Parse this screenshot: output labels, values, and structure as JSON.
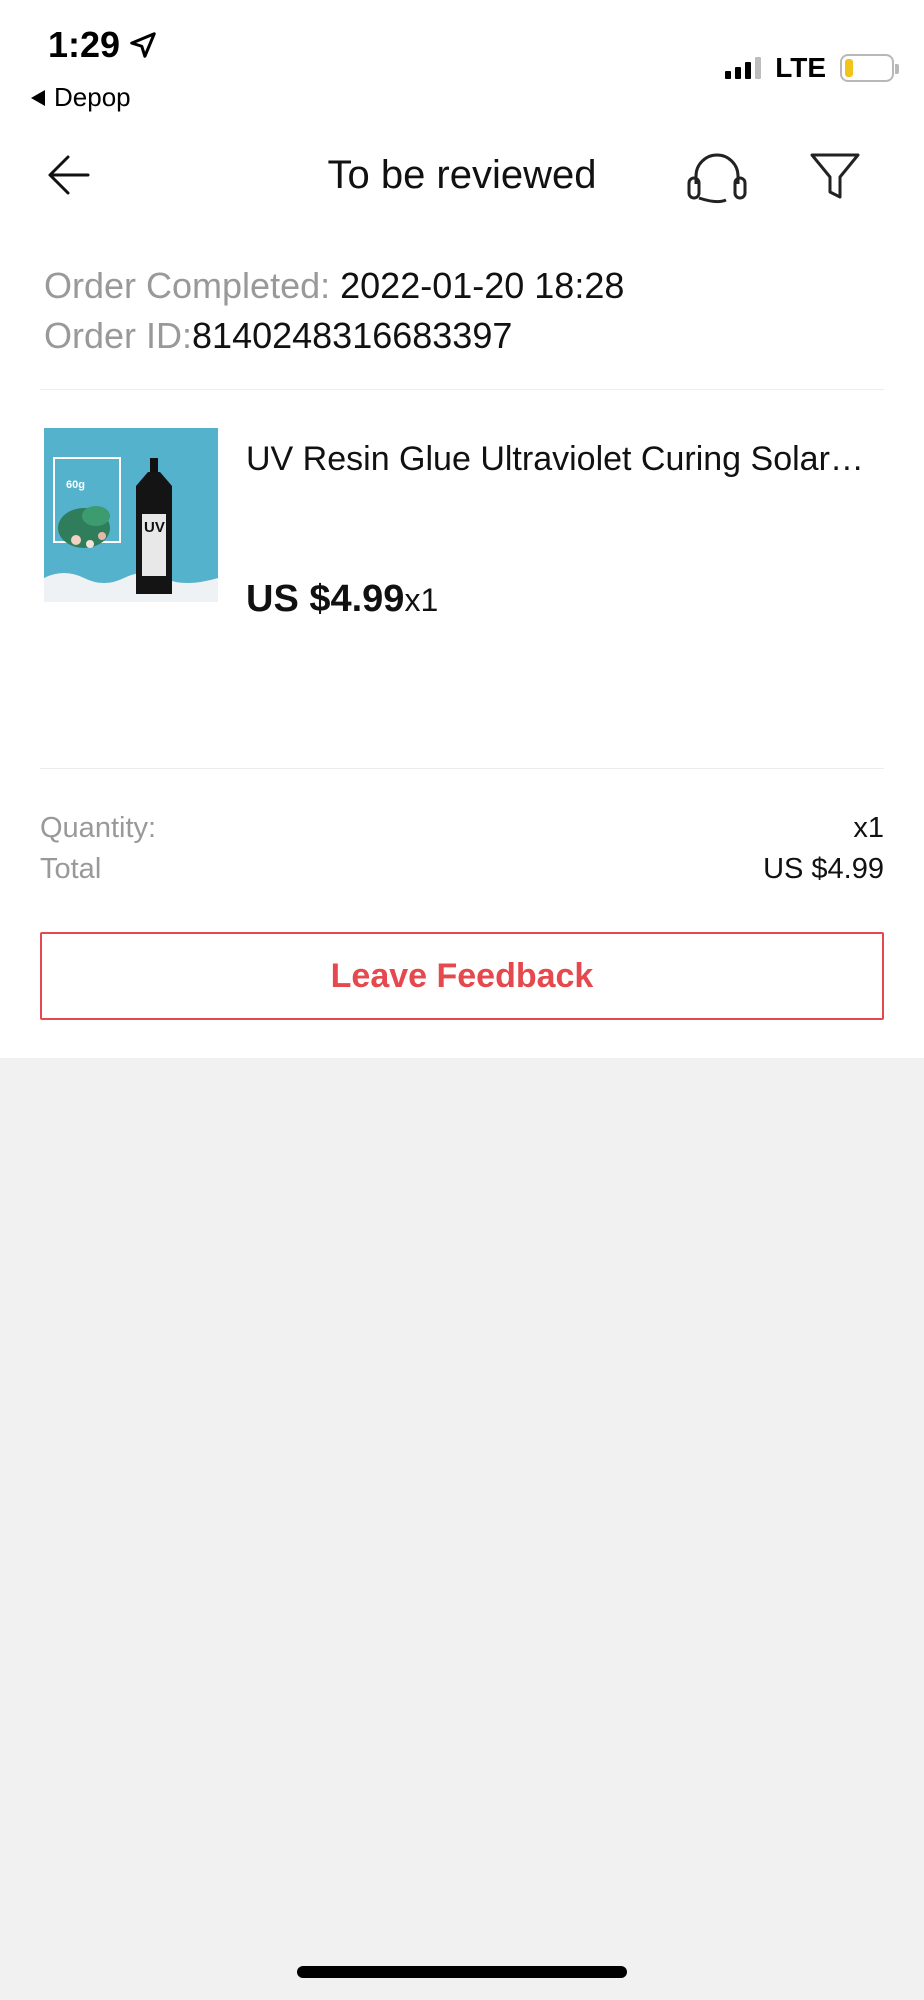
{
  "status_bar": {
    "time": "1:29",
    "back_app": "Depop",
    "network": "LTE"
  },
  "header": {
    "title": "To be reviewed"
  },
  "order": {
    "completed_label": "Order Completed:",
    "completed_value": " 2022-01-20 18:28",
    "id_label": "Order ID:",
    "id_value": "8140248316683397"
  },
  "product": {
    "title": "UV Resin Glue Ultraviolet Curing Solar…",
    "price": "US $4.99",
    "quantity": "x1",
    "image_text_weight": "60g",
    "image_text_brand": "UV"
  },
  "summary": {
    "quantity_label": "Quantity:",
    "quantity_value": "x1",
    "total_label": "Total",
    "total_value": "US $4.99"
  },
  "actions": {
    "leave_feedback": "Leave Feedback"
  },
  "colors": {
    "accent": "#e5484d",
    "muted_text": "#999999",
    "background": "#f1f1f1"
  },
  "icons": {
    "back": "arrow-left-icon",
    "support": "headset-icon",
    "filter": "filter-icon",
    "location": "location-arrow-icon"
  }
}
